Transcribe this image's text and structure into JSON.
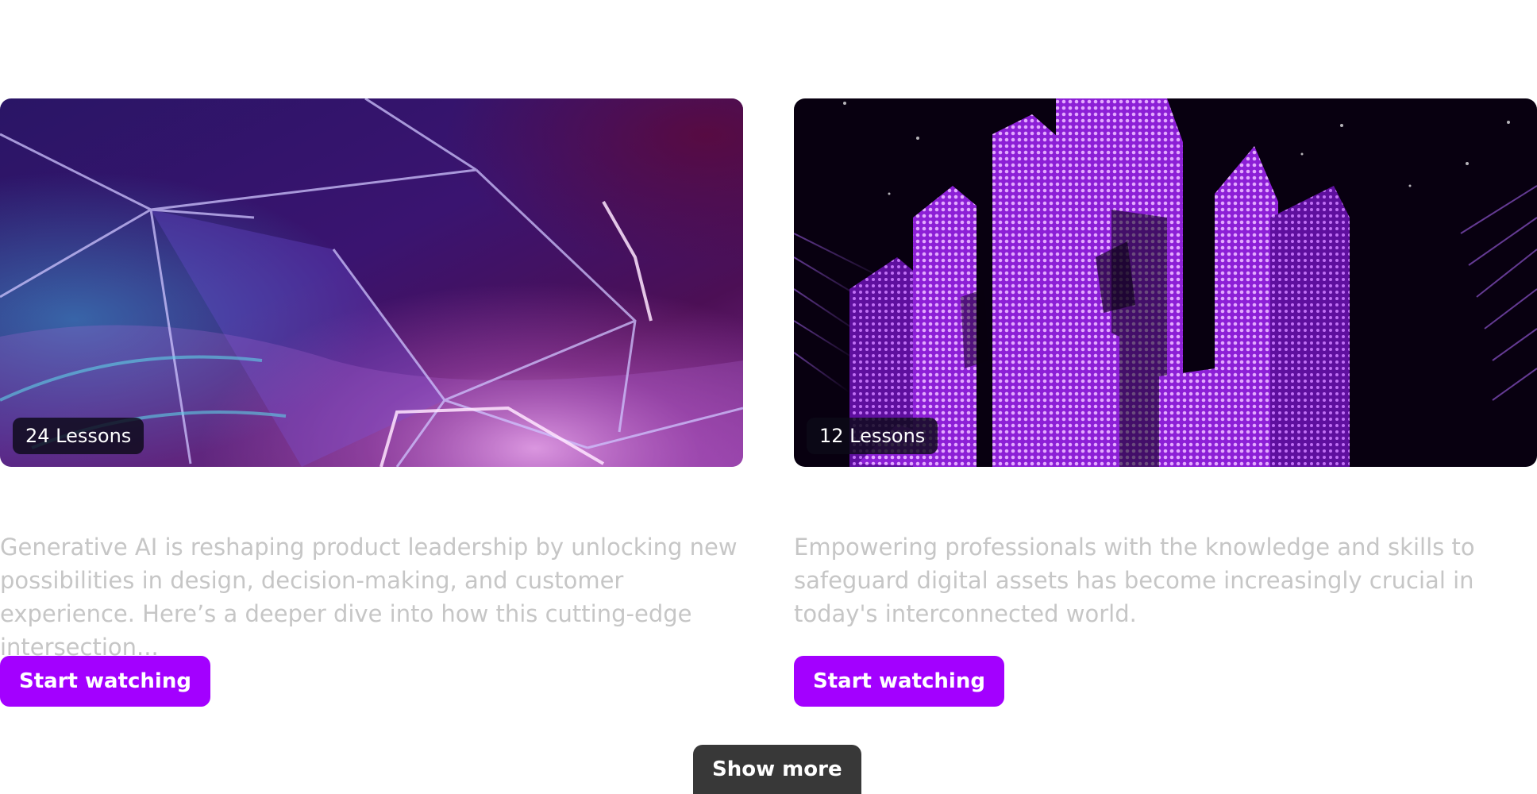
{
  "courses": [
    {
      "lessons_badge": "24 Lessons",
      "description": "Generative AI is reshaping product leadership by unlocking new possibilities in design, decision-making, and customer experience. Here’s a deeper dive into how this cutting-edge intersection...",
      "cta_label": "Start watching",
      "thumbnail_icon": "abstract-purple-mesh-image"
    },
    {
      "lessons_badge": "12 Lessons",
      "description": "Empowering professionals with the knowledge and skills to safeguard digital assets has become increasingly crucial in today's interconnected world.",
      "cta_label": "Start watching",
      "thumbnail_icon": "purple-particle-city-image"
    }
  ],
  "show_more_label": "Show more",
  "colors": {
    "accent": "#a300ff",
    "show_more_bg": "#383838",
    "description_text": "#c6c6c6",
    "badge_bg": "#0c0a18"
  }
}
